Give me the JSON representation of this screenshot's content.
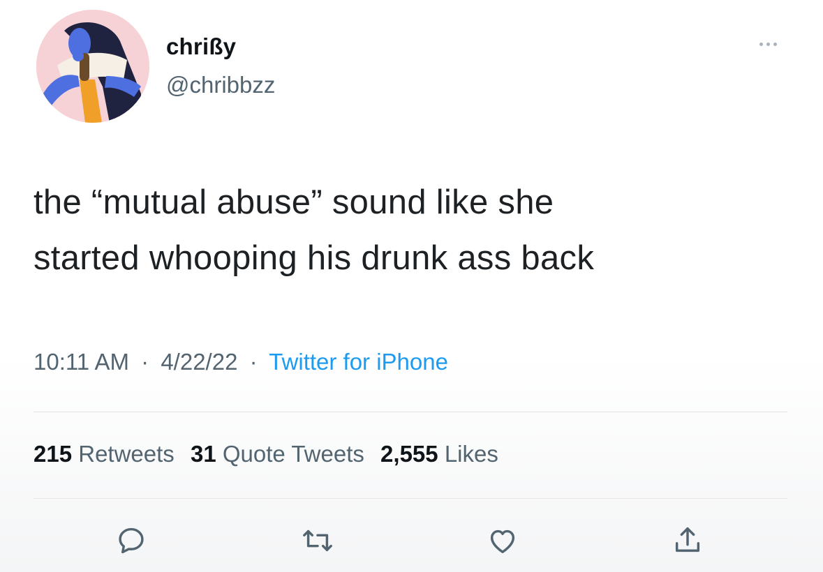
{
  "tweet": {
    "display_name": "chrißy",
    "handle": "@chribbzz",
    "text_line1": "the “mutual abuse” sound like she",
    "text_line2": "started whooping his drunk ass back",
    "time": "10:11 AM",
    "separator": "·",
    "date": "4/22/22",
    "source": "Twitter for iPhone",
    "stats": {
      "retweets_count": "215",
      "retweets_label": "Retweets",
      "quotes_count": "31",
      "quotes_label": "Quote Tweets",
      "likes_count": "2,555",
      "likes_label": "Likes"
    }
  },
  "icons": {
    "more": "more-icon",
    "reply": "reply-icon",
    "retweet": "retweet-icon",
    "like": "heart-icon",
    "share": "share-icon"
  },
  "colors": {
    "link": "#1d9bf0",
    "secondary_text": "#536471",
    "avatar_bg": "#f6d2d6"
  }
}
